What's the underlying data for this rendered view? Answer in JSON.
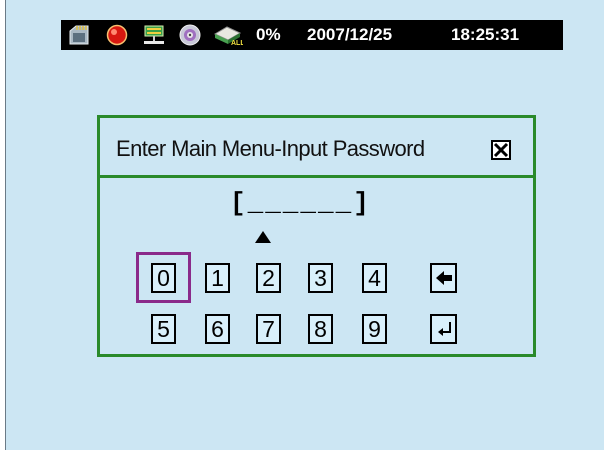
{
  "status_bar": {
    "icons": [
      "memory-card-icon",
      "record-icon",
      "network-icon",
      "disc-icon",
      "hdd-alarm-icon"
    ],
    "percent": "0%",
    "date": "2007/12/25",
    "time": "18:25:31"
  },
  "dialog": {
    "title": "Enter Main Menu-Input Password",
    "password_mask": "[______]",
    "selected_key": "0",
    "keys_row1": [
      "0",
      "1",
      "2",
      "3",
      "4"
    ],
    "keys_row2": [
      "5",
      "6",
      "7",
      "8",
      "9"
    ],
    "backspace_icon": "left-arrow-icon",
    "enter_icon": "enter-return-icon"
  },
  "colors": {
    "screen_bg": "#cce6f3",
    "dialog_border": "#2a8a2a",
    "selection": "#8a2a8a",
    "status_bg": "#000000"
  }
}
